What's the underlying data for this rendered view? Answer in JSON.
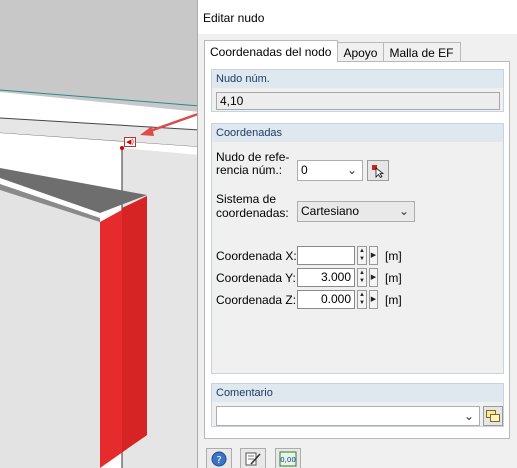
{
  "dialog": {
    "title": "Editar nudo",
    "tabs": [
      {
        "label": "Coordenadas del nodo",
        "active": true
      },
      {
        "label": "Apoyo",
        "active": false
      },
      {
        "label": "Malla de EF",
        "active": false
      }
    ]
  },
  "node_group": {
    "header": "Nudo núm.",
    "value": "4,10"
  },
  "coords_group": {
    "header": "Coordenadas",
    "reference_label_1": "Nudo de refe-",
    "reference_label_2": "rencia núm.:",
    "reference_value": "0",
    "system_label_1": "Sistema de",
    "system_label_2": "coordenadas:",
    "system_value": "Cartesiano",
    "fields": [
      {
        "label": "Coordenada X:",
        "value": "",
        "unit": "[m]"
      },
      {
        "label": "Coordenada Y:",
        "value": "3.000",
        "unit": "[m]"
      },
      {
        "label": "Coordenada Z:",
        "value": "0.000",
        "unit": "[m]"
      }
    ]
  },
  "comment_group": {
    "header": "Comentario",
    "value": ""
  },
  "footer": {
    "buttons": [
      "help-icon",
      "edit-icon",
      "units-icon"
    ],
    "units_text": "0,00"
  },
  "viewport": {
    "node_label": "◀)",
    "colors": {
      "accent_red": "#e52b2b",
      "arrow_red": "#e04a4a",
      "gray_face": "#e2e2e2",
      "dark_face": "#6f6f6f",
      "group_header": "#dfe7ef"
    }
  }
}
